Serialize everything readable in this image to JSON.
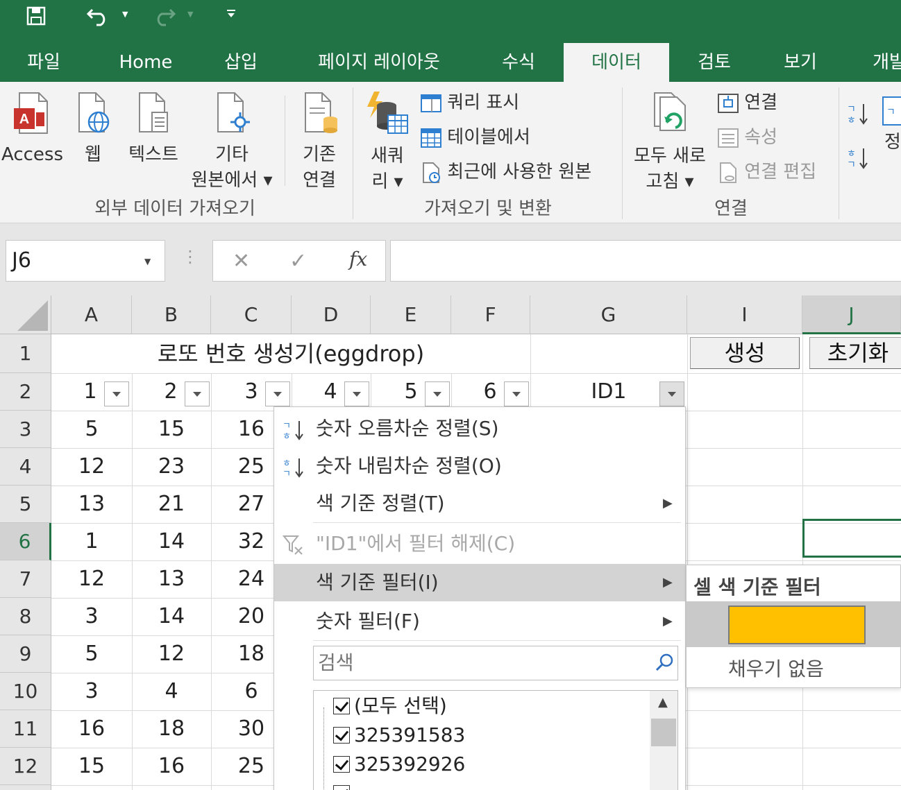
{
  "colors": {
    "accent": "#217346",
    "swatch": "#ffc000"
  },
  "qat": {
    "save_icon": "save-icon",
    "undo_icon": "undo-icon",
    "redo_icon": "redo-icon",
    "customize_icon": "customize-qat-icon"
  },
  "tabs": [
    {
      "label": "파일"
    },
    {
      "label": "Home"
    },
    {
      "label": "삽입"
    },
    {
      "label": "페이지 레이아웃"
    },
    {
      "label": "수식"
    },
    {
      "label": "데이터"
    },
    {
      "label": "검토"
    },
    {
      "label": "보기"
    },
    {
      "label": "개발"
    }
  ],
  "ribbon": {
    "external": {
      "access": "Access",
      "web": "웹",
      "text": "텍스트",
      "other_1": "기타",
      "other_2": "원본에서 ▾",
      "group_label": "외부 데이터 가져오기"
    },
    "existing": {
      "line1": "기존",
      "line2": "연결"
    },
    "transform": {
      "newquery_1": "새쿼",
      "newquery_2": "리 ▾",
      "show_query": "쿼리 표시",
      "from_table": "테이블에서",
      "recent": "최근에 사용한 원본",
      "group_label": "가져오기 및 변환"
    },
    "connections": {
      "refresh_1": "모두 새로",
      "refresh_2": "고침 ▾",
      "connections": "연결",
      "properties": "속성",
      "edit_links": "연결 편집",
      "group_label": "연결"
    },
    "sort": {
      "label": "정"
    }
  },
  "formula_bar": {
    "name_box": "J6",
    "cancel": "✕",
    "enter": "✓",
    "fx": "fx",
    "value": ""
  },
  "columns": [
    "A",
    "B",
    "C",
    "D",
    "E",
    "F",
    "G",
    "I",
    "J"
  ],
  "rows": [
    "1",
    "2",
    "3",
    "4",
    "5",
    "6",
    "7",
    "8",
    "9",
    "10",
    "11",
    "12"
  ],
  "sheet": {
    "title": "로또 번호 생성기(eggdrop)",
    "headers": [
      "1",
      "2",
      "3",
      "4",
      "5",
      "6",
      "ID1"
    ],
    "data": [
      [
        "5",
        "15",
        "16"
      ],
      [
        "12",
        "23",
        "25"
      ],
      [
        "13",
        "21",
        "27"
      ],
      [
        "1",
        "14",
        "32"
      ],
      [
        "12",
        "13",
        "24"
      ],
      [
        "3",
        "14",
        "20"
      ],
      [
        "5",
        "12",
        "18"
      ],
      [
        "3",
        "4",
        "6"
      ],
      [
        "16",
        "18",
        "30"
      ],
      [
        "15",
        "16",
        "25"
      ]
    ],
    "button_generate": "생성",
    "button_reset": "초기화"
  },
  "filter_menu": {
    "sort_asc": "숫자 오름차순 정렬(S)",
    "sort_desc": "숫자 내림차순 정렬(O)",
    "sort_color": "색 기준 정렬(T)",
    "clear_filter": "\"ID1\"에서 필터 해제(C)",
    "filter_color": "색 기준 필터(I)",
    "number_filter": "숫자 필터(F)",
    "search_placeholder": "검색",
    "list": [
      "(모두 선택)",
      "325391583",
      "325392926"
    ]
  },
  "color_submenu": {
    "title": "셀 색 기준 필터",
    "no_fill": "채우기 없음"
  }
}
